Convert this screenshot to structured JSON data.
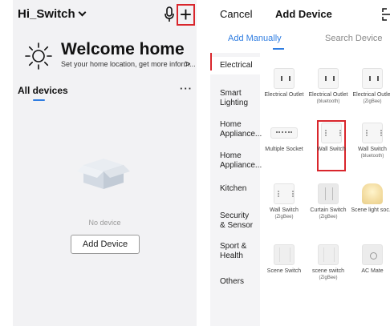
{
  "left_screen": {
    "home_name": "Hi_Switch",
    "welcome_title": "Welcome home",
    "welcome_subtitle": "Set your home location, get more inform...",
    "welcome_arrow": ">",
    "devices_title": "All devices",
    "more_label": "···",
    "empty_text": "No device",
    "add_button_label": "Add Device"
  },
  "right_screen": {
    "cancel_label": "Cancel",
    "title": "Add Device",
    "tabs": {
      "manual": "Add Manually",
      "search": "Search Device"
    },
    "categories": [
      {
        "label": "Electrical",
        "active": true
      },
      {
        "label": "Smart Lighting"
      },
      {
        "label": "Home Appliance..."
      },
      {
        "label": "Home Appliance..."
      },
      {
        "label": "Kitchen"
      },
      {
        "label": "Security & Sensor"
      },
      {
        "label": "Sport & Health"
      },
      {
        "label": "Others"
      }
    ],
    "devices": [
      {
        "label": "Electrical Outlet",
        "sub": "",
        "icon": "outlet-icon"
      },
      {
        "label": "Electrical Outlet",
        "sub": "(bluetooth)",
        "icon": "outlet-icon"
      },
      {
        "label": "Electrical Outlet",
        "sub": "(ZigBee)",
        "icon": "outlet-icon"
      },
      {
        "label": "Multiple Socket",
        "sub": "",
        "icon": "power-strip-icon"
      },
      {
        "label": "Wall Switch",
        "sub": "",
        "icon": "wall-switch-icon",
        "highlighted": true
      },
      {
        "label": "Wall Switch",
        "sub": "(bluetooth)",
        "icon": "wall-switch-icon"
      },
      {
        "label": "Wall Switch",
        "sub": "(ZigBee)",
        "icon": "wall-switch-icon"
      },
      {
        "label": "Curtain Switch",
        "sub": "(ZigBee)",
        "icon": "curtain-switch-icon"
      },
      {
        "label": "Scene light soc...",
        "sub": "",
        "icon": "scene-light-icon"
      },
      {
        "label": "Scene Switch",
        "sub": "",
        "icon": "scene-switch-icon"
      },
      {
        "label": "scene switch",
        "sub": "(ZigBee)",
        "icon": "scene-switch-icon"
      },
      {
        "label": "AC Mate",
        "sub": "",
        "icon": "ac-mate-icon"
      }
    ]
  },
  "colors": {
    "accent": "#2f7de1",
    "highlight": "#d9262c"
  }
}
